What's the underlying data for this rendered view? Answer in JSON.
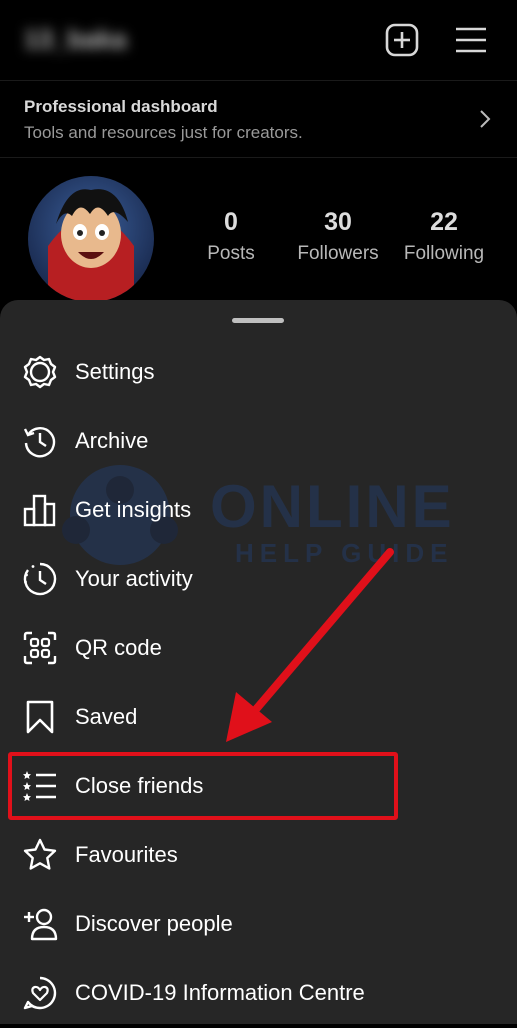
{
  "profile": {
    "username": "13_baka",
    "dashboard_title": "Professional dashboard",
    "dashboard_subtitle": "Tools and resources just for creators.",
    "stats": [
      {
        "value": "0",
        "label": "Posts"
      },
      {
        "value": "30",
        "label": "Followers"
      },
      {
        "value": "22",
        "label": "Following"
      }
    ]
  },
  "menu": {
    "items": [
      {
        "label": "Settings",
        "icon": "gear-icon"
      },
      {
        "label": "Archive",
        "icon": "archive-icon"
      },
      {
        "label": "Get insights",
        "icon": "insights-icon"
      },
      {
        "label": "Your activity",
        "icon": "activity-icon"
      },
      {
        "label": "QR code",
        "icon": "qr-code-icon"
      },
      {
        "label": "Saved",
        "icon": "bookmark-icon"
      },
      {
        "label": "Close friends",
        "icon": "close-friends-icon"
      },
      {
        "label": "Favourites",
        "icon": "star-icon"
      },
      {
        "label": "Discover people",
        "icon": "add-person-icon"
      },
      {
        "label": "COVID-19 Information Centre",
        "icon": "heart-chat-icon"
      }
    ]
  },
  "watermark": {
    "text": "ONLINE",
    "subtext": "HELP GUIDE"
  },
  "colors": {
    "background": "#000000",
    "sheet": "#262626",
    "highlight": "#e0101a"
  }
}
